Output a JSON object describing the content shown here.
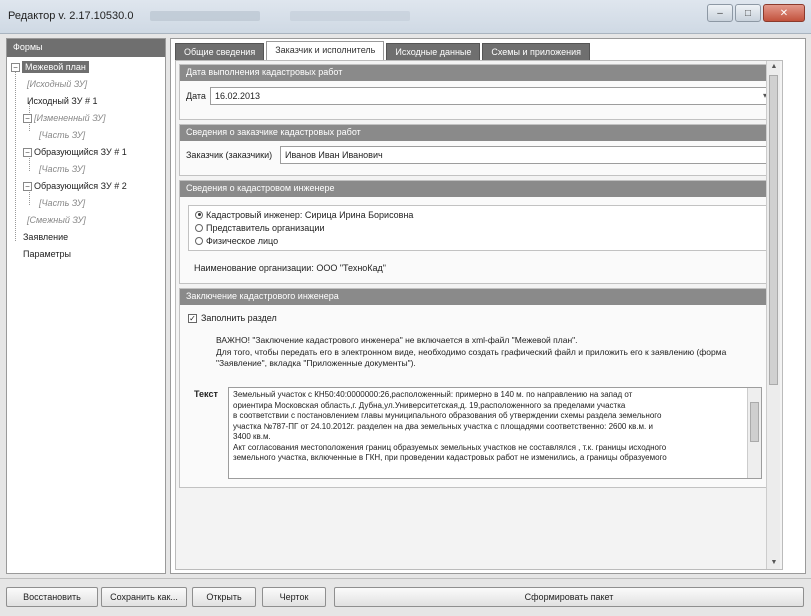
{
  "window": {
    "title": "Редактор v. 2.17.10530.0",
    "controls": {
      "minimize": "–",
      "maximize": "□",
      "close": "✕"
    }
  },
  "tree": {
    "header": "Формы",
    "items": [
      {
        "label": "Межевой план",
        "selected": true
      },
      {
        "label": "[Исходный ЗУ]",
        "muted": true
      },
      {
        "label": "Исходный ЗУ # 1"
      },
      {
        "label": "[Измененный ЗУ]",
        "muted": true
      },
      {
        "label": "[Часть ЗУ]",
        "muted": true
      },
      {
        "label": "Образующийся ЗУ # 1"
      },
      {
        "label": "[Часть ЗУ]",
        "muted": true
      },
      {
        "label": "Образующийся ЗУ # 2"
      },
      {
        "label": "[Часть ЗУ]",
        "muted": true
      },
      {
        "label": "[Смежный ЗУ]",
        "muted": true
      },
      {
        "label": "Заявление"
      },
      {
        "label": "Параметры"
      }
    ]
  },
  "tabs": [
    {
      "label": "Общие сведения",
      "active": false
    },
    {
      "label": "Заказчик и исполнитель",
      "active": true
    },
    {
      "label": "Исходные данные",
      "active": false
    },
    {
      "label": "Схемы и приложения",
      "active": false
    }
  ],
  "date_section": {
    "header": "Дата выполнения кадастровых работ",
    "label": "Дата",
    "value": "16.02.2013"
  },
  "customer_section": {
    "header": "Сведения о заказчике кадастровых работ",
    "label": "Заказчик (заказчики)",
    "value": "Иванов Иван Иванович"
  },
  "engineer_section": {
    "header": "Сведения о кадастровом инженере",
    "options": [
      {
        "label": "Кадастровый инженер: Сирица Ирина Борисовна",
        "selected": true
      },
      {
        "label": "Представитель организации",
        "selected": false
      },
      {
        "label": "Физическое лицо",
        "selected": false
      }
    ],
    "org_label": "Наименование организации: ООО \"ТехноКад\""
  },
  "conclusion_section": {
    "header": "Заключение кадастрового инженера",
    "checkbox_label": "Заполнить раздел",
    "checked": true,
    "note_line1": "ВАЖНО! \"Заключение кадастрового инженера\" не включается в xml-файл \"Межевой план\".",
    "note_line2": "Для того, чтобы передать его в электронном виде, необходимо создать графический файл и приложить его к заявлению (форма \"Заявление\", вкладка \"Приложенные документы\").",
    "text_label": "Текст",
    "text_lines": [
      "Земельный участок с КН50:40:0000000:26,расположенный: примерно в 140 м. по направлению на запад от",
      "ориентира Московская область,г. Дубна,ул.Университетская,д. 19,расположенного  за пределами участка",
      "в  соответствии с постановлением главы муниципального образования об утверждении  схемы раздела земельного",
      "участка   №787-ПГ от 24.10.2012г.  разделен на два  земельных участка с площадями соответственно: 2600 кв.м.  и",
      "3400 кв.м.",
      "Акт согласования местоположения границ образуемых земельных участков не составлялся , т.к. границы исходного",
      "земельного участка, включенные в ГКН, при проведении кадастровых работ  не изменились, а границы образуемого"
    ]
  },
  "bottom_buttons": {
    "restore": "Восстановить",
    "save_as": "Сохранить как...",
    "open": "Открыть",
    "draft": "Черток",
    "generate": "Сформировать пакет"
  }
}
